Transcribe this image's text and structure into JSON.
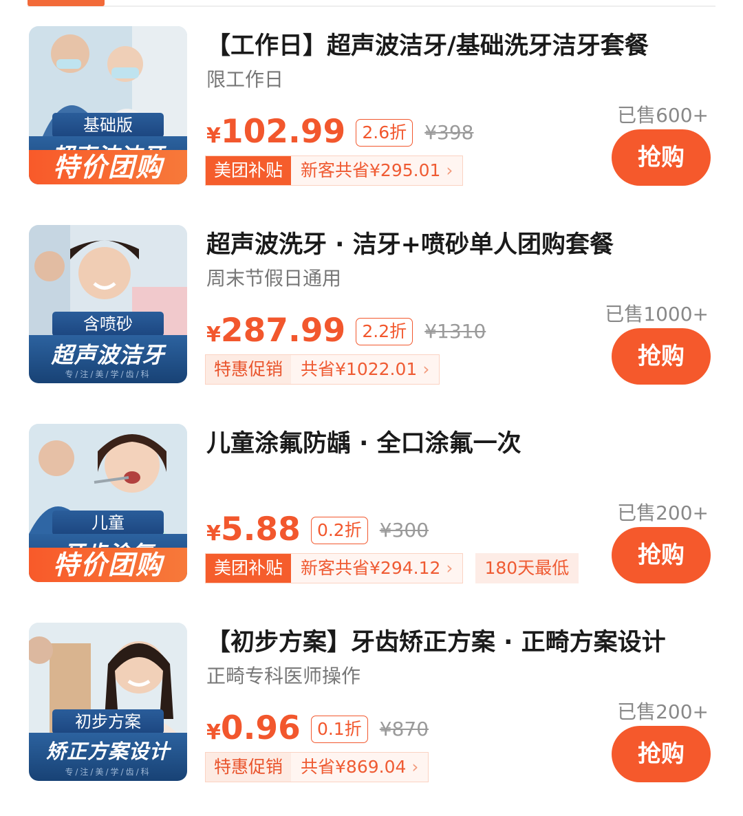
{
  "deals": [
    {
      "title": "【工作日】超声波洁牙/基础洗牙洁牙套餐",
      "subtitle": "限工作日",
      "thumb": {
        "tag": "基础版",
        "headline": "超声波洁牙",
        "slogan": "",
        "promo": "特价团购"
      },
      "currency": "¥",
      "price": "102.99",
      "discount": "2.6折",
      "original_price": "¥398",
      "promo_label": "美团补贴",
      "promo_label_style": "solid",
      "promo_detail": "新客共省¥295.01",
      "extra_badge": "",
      "sold": "已售600+",
      "buy_label": "抢购"
    },
    {
      "title": "超声波洗牙 · 洁牙+喷砂单人团购套餐",
      "subtitle": "周末节假日通用",
      "thumb": {
        "tag": "含喷砂",
        "headline": "超声波洁牙",
        "slogan": "专/注/美/学/齿/科",
        "promo": ""
      },
      "currency": "¥",
      "price": "287.99",
      "discount": "2.2折",
      "original_price": "¥1310",
      "promo_label": "特惠促销",
      "promo_label_style": "light",
      "promo_detail": "共省¥1022.01",
      "extra_badge": "",
      "sold": "已售1000+",
      "buy_label": "抢购"
    },
    {
      "title": "儿童涂氟防龋 · 全口涂氟一次",
      "subtitle": "",
      "thumb": {
        "tag": "儿童",
        "headline": "牙齿涂氟",
        "slogan": "",
        "promo": "特价团购"
      },
      "currency": "¥",
      "price": "5.88",
      "discount": "0.2折",
      "original_price": "¥300",
      "promo_label": "美团补贴",
      "promo_label_style": "solid",
      "promo_detail": "新客共省¥294.12",
      "extra_badge": "180天最低",
      "sold": "已售200+",
      "buy_label": "抢购"
    },
    {
      "title": "【初步方案】牙齿矫正方案 · 正畸方案设计",
      "subtitle": "正畸专科医师操作",
      "thumb": {
        "tag": "初步方案",
        "headline": "矫正方案设计",
        "slogan": "专/注/美/学/齿/科",
        "promo": ""
      },
      "currency": "¥",
      "price": "0.96",
      "discount": "0.1折",
      "original_price": "¥870",
      "promo_label": "特惠促销",
      "promo_label_style": "light",
      "promo_detail": "共省¥869.04",
      "extra_badge": "",
      "sold": "已售200+",
      "buy_label": "抢购"
    }
  ],
  "colors": {
    "accent": "#f5592c",
    "price": "#f2572d",
    "thumb_band": "#1c4680"
  },
  "icons": {
    "promo_chevron": "chevron-right-icon"
  }
}
